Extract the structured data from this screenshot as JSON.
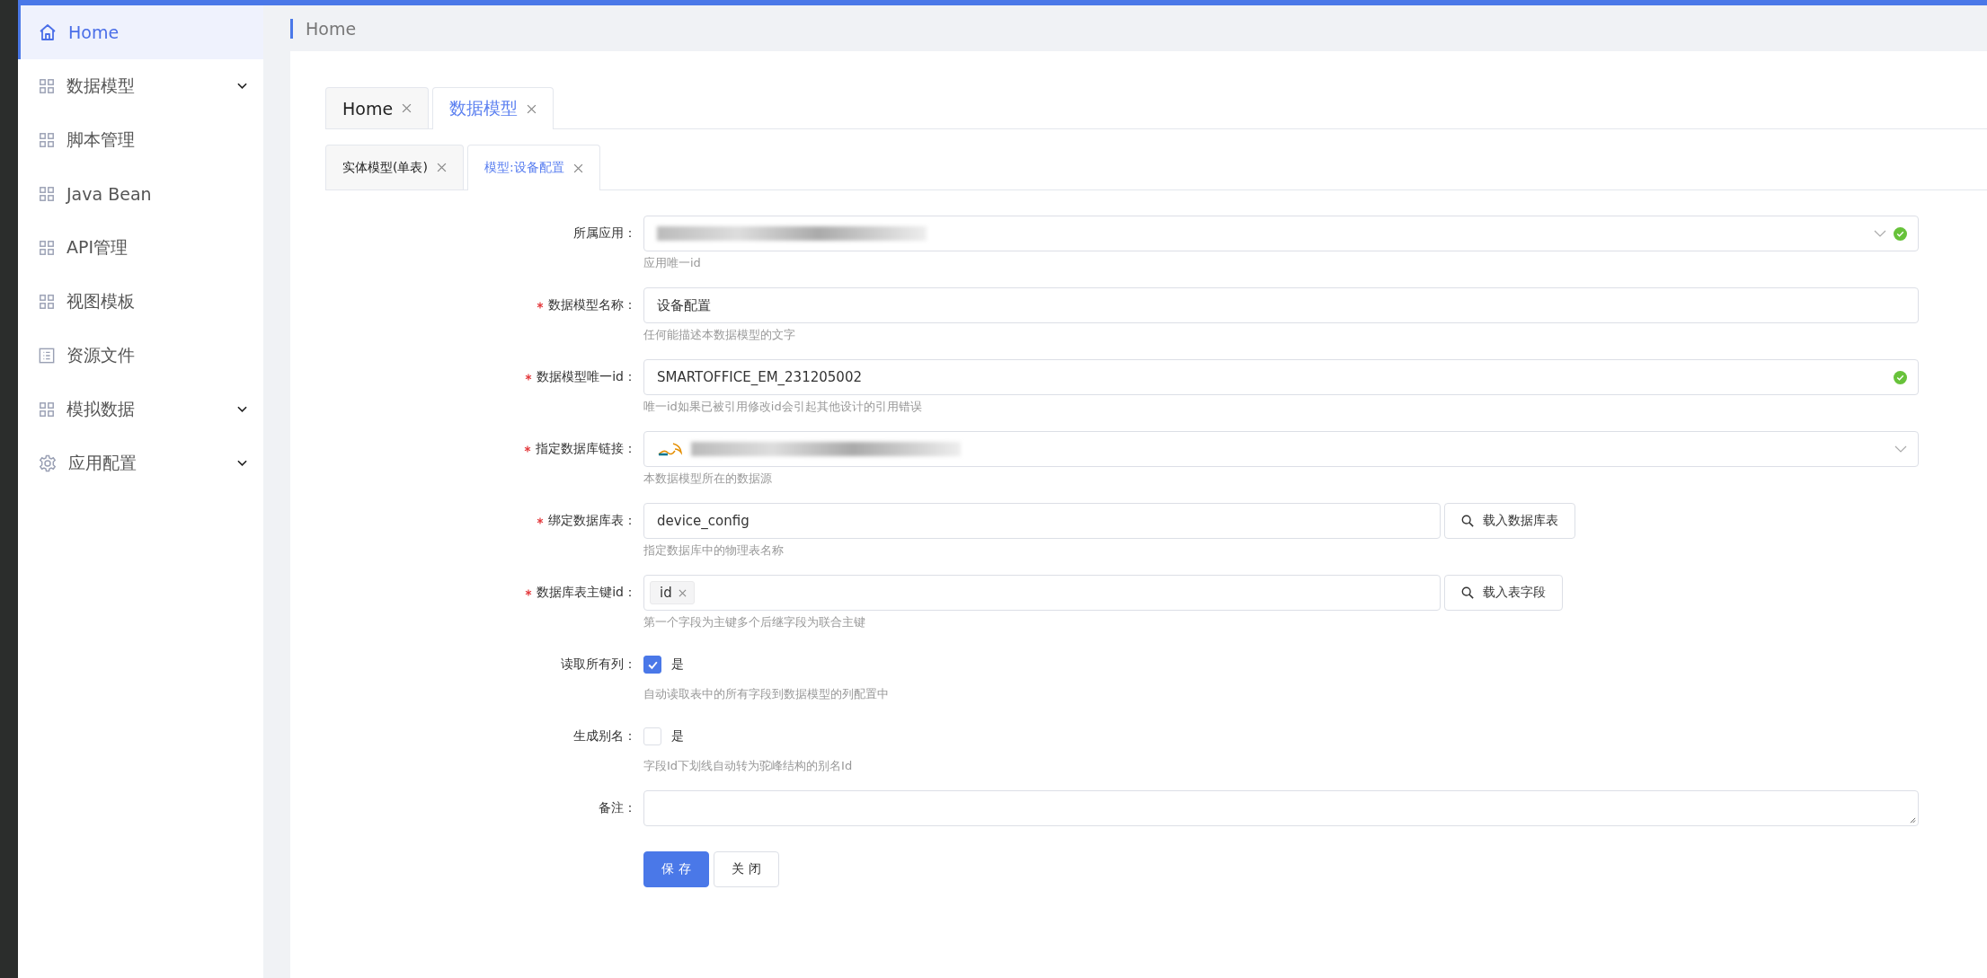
{
  "sidebar": {
    "items": [
      {
        "label": "Home",
        "kind": "home",
        "selected": true,
        "submenu": false
      },
      {
        "label": "数据模型",
        "kind": "grid",
        "selected": false,
        "submenu": true
      },
      {
        "label": "脚本管理",
        "kind": "grid",
        "selected": false,
        "submenu": false
      },
      {
        "label": "Java Bean",
        "kind": "grid",
        "selected": false,
        "submenu": false
      },
      {
        "label": "API管理",
        "kind": "grid",
        "selected": false,
        "submenu": false
      },
      {
        "label": "视图模板",
        "kind": "grid",
        "selected": false,
        "submenu": false
      },
      {
        "label": "资源文件",
        "kind": "list",
        "selected": false,
        "submenu": false
      },
      {
        "label": "模拟数据",
        "kind": "grid",
        "selected": false,
        "submenu": true
      },
      {
        "label": "应用配置",
        "kind": "gear",
        "selected": false,
        "submenu": true
      }
    ]
  },
  "breadcrumb": "Home",
  "tabs": [
    {
      "label": "Home",
      "selected": false
    },
    {
      "label": "数据模型",
      "selected": true
    }
  ],
  "subtabs": [
    {
      "label": "实体模型(单表)",
      "selected": false
    },
    {
      "label": "模型:设备配置",
      "selected": true
    }
  ],
  "form": {
    "fields": [
      {
        "kind": "select",
        "label": "所属应用：",
        "required": false,
        "redacted": true,
        "db_logo": false,
        "valid": true,
        "help": "应用唯一id"
      },
      {
        "kind": "text",
        "label": "数据模型名称：",
        "required": true,
        "value": "设备配置",
        "valid": false,
        "help": "任何能描述本数据模型的文字"
      },
      {
        "kind": "text",
        "label": "数据模型唯一id：",
        "required": true,
        "value": "SMARTOFFICE_EM_231205002",
        "valid": true,
        "help": "唯一id如果已被引用修改id会引起其他设计的引用错误"
      },
      {
        "kind": "select",
        "label": "指定数据库链接：",
        "required": true,
        "redacted": true,
        "db_logo": true,
        "valid": false,
        "help": "本数据模型所在的数据源"
      },
      {
        "kind": "text_button",
        "label": "绑定数据库表：",
        "required": true,
        "value": "device_config",
        "button": "载入数据库表",
        "help": "指定数据库中的物理表名称"
      },
      {
        "kind": "tags_button",
        "label": "数据库表主键id：",
        "required": true,
        "tags": [
          "id"
        ],
        "button": "载入表字段",
        "help": "第一个字段为主键多个后继字段为联合主键"
      },
      {
        "kind": "checkbox",
        "label": "读取所有列：",
        "required": false,
        "checked": true,
        "option": "是",
        "help": "自动读取表中的所有字段到数据模型的列配置中"
      },
      {
        "kind": "checkbox",
        "label": "生成别名：",
        "required": false,
        "checked": false,
        "option": "是",
        "help": "字段Id下划线自动转为驼峰结构的别名Id"
      },
      {
        "kind": "textarea",
        "label": "备注：",
        "required": false
      }
    ],
    "actions": [
      {
        "label": "保 存",
        "primary": true
      },
      {
        "label": "关 闭",
        "primary": false
      }
    ]
  }
}
